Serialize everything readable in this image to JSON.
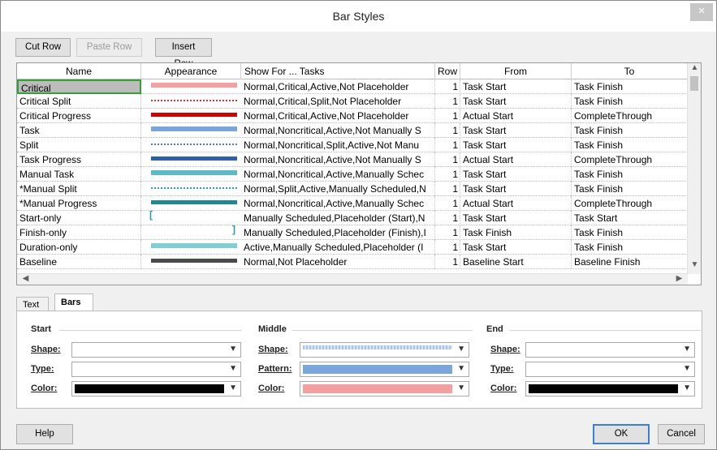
{
  "window": {
    "title": "Bar Styles",
    "close_glyph": "×"
  },
  "toolbar": {
    "cut": "Cut Row",
    "paste": "Paste Row",
    "insert": "Insert Row"
  },
  "table": {
    "headers": [
      "Name",
      "Appearance",
      "Show For ... Tasks",
      "Row",
      "From",
      "To"
    ],
    "rows": [
      {
        "name": "Critical",
        "show": "Normal,Critical,Active,Not Placeholder",
        "row": "1",
        "from": "Task Start",
        "to": "Task Finish",
        "appearance": {
          "style": "solid",
          "color": "#f4a0a0"
        }
      },
      {
        "name": "Critical Split",
        "show": "Normal,Critical,Split,Not Placeholder",
        "row": "1",
        "from": "Task Start",
        "to": "Task Finish",
        "appearance": {
          "style": "dotted",
          "color": "#e03030"
        }
      },
      {
        "name": "Critical Progress",
        "show": "Normal,Critical,Active,Not Placeholder",
        "row": "1",
        "from": "Actual Start",
        "to": "CompleteThrough",
        "appearance": {
          "style": "thick",
          "color": "#d40000"
        }
      },
      {
        "name": "Task",
        "show": "Normal,Noncritical,Active,Not Manually S",
        "row": "1",
        "from": "Task Start",
        "to": "Task Finish",
        "appearance": {
          "style": "solid",
          "color": "#7aa6de"
        }
      },
      {
        "name": "Split",
        "show": "Normal,Noncritical,Split,Active,Not Manu",
        "row": "1",
        "from": "Task Start",
        "to": "Task Finish",
        "appearance": {
          "style": "dotted",
          "color": "#4a7ec8"
        }
      },
      {
        "name": "Task Progress",
        "show": "Normal,Noncritical,Active,Not Manually S",
        "row": "1",
        "from": "Actual Start",
        "to": "CompleteThrough",
        "appearance": {
          "style": "thick",
          "color": "#2d5fb0"
        }
      },
      {
        "name": "Manual Task",
        "show": "Normal,Noncritical,Active,Manually Schec",
        "row": "1",
        "from": "Task Start",
        "to": "Task Finish",
        "appearance": {
          "style": "solid",
          "color": "#5bbcc0"
        }
      },
      {
        "name": "*Manual Split",
        "show": "Normal,Split,Active,Manually Scheduled,N",
        "row": "1",
        "from": "Task Start",
        "to": "Task Finish",
        "appearance": {
          "style": "dotted",
          "color": "#2aa0a8"
        }
      },
      {
        "name": "*Manual Progress",
        "show": "Normal,Noncritical,Active,Manually Schec",
        "row": "1",
        "from": "Actual Start",
        "to": "CompleteThrough",
        "appearance": {
          "style": "thick",
          "color": "#1d8a90"
        }
      },
      {
        "name": "Start-only",
        "show": "Manually Scheduled,Placeholder (Start),N",
        "row": "1",
        "from": "Task Start",
        "to": "Task Start",
        "appearance": {
          "style": "start-bracket",
          "color": "#2a9aa0"
        }
      },
      {
        "name": "Finish-only",
        "show": "Manually Scheduled,Placeholder (Finish),I",
        "row": "1",
        "from": "Task Finish",
        "to": "Task Finish",
        "appearance": {
          "style": "end-bracket",
          "color": "#2a9aa0"
        }
      },
      {
        "name": "Duration-only",
        "show": "Active,Manually Scheduled,Placeholder (I",
        "row": "1",
        "from": "Task Start",
        "to": "Task Finish",
        "appearance": {
          "style": "solid",
          "color": "#7fd0d4"
        }
      },
      {
        "name": "Baseline",
        "show": "Normal,Not Placeholder",
        "row": "1",
        "from": "Baseline Start",
        "to": "Baseline Finish",
        "appearance": {
          "style": "thick",
          "color": "#4a4a4a"
        }
      }
    ]
  },
  "tabs": [
    "Text",
    "Bars"
  ],
  "panel": {
    "start": {
      "title": "Start",
      "shape": "Shape:",
      "type": "Type:",
      "color": "Color:",
      "color_value": "#000000"
    },
    "middle": {
      "title": "Middle",
      "shape": "Shape:",
      "pattern": "Pattern:",
      "color": "Color:",
      "color_value": "#f4a0a0",
      "pattern_color": "#7aa6de"
    },
    "end": {
      "title": "End",
      "shape": "Shape:",
      "type": "Type:",
      "color": "Color:",
      "color_value": "#000000"
    }
  },
  "footer": {
    "help": "Help",
    "ok": "OK",
    "cancel": "Cancel"
  }
}
